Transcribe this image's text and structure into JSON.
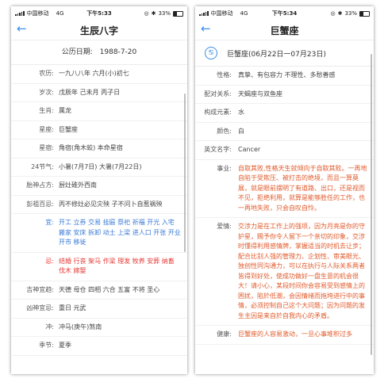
{
  "status": {
    "carrier": "中国移动",
    "network": "4G",
    "battery": "33%",
    "time_left": "下午5:33",
    "time_right": "下午5:34"
  },
  "left": {
    "title": "生辰八字",
    "date_label": "公历日期:",
    "date_value": "1988-7-20",
    "rows": [
      {
        "label": "农历:",
        "value": "一九八八年 六月(小)初七"
      },
      {
        "label": "岁次:",
        "value": "戊辰年 己未月 丙子日"
      },
      {
        "label": "生肖:",
        "value": "属龙"
      },
      {
        "label": "星座:",
        "value": "巨蟹座"
      },
      {
        "label": "星宿:",
        "value": "角宿(角木蛟) 本命星宿"
      },
      {
        "label": "24节气:",
        "value": "小暑(7月7日) 大暑(7月22日)"
      },
      {
        "label": "胎神占方:",
        "value": "厨灶碓外西南"
      },
      {
        "label": "彭祖百忌:",
        "value": "丙不修灶必见灾殃 子不问卜自惹祸殃"
      },
      {
        "label": "宜:",
        "value": "开工 立券 交易 挂匾 祭祀 祈福 开光 入宅 搬家 安床 拆卸 动土 上梁 进人口 开张 开业 开市 移徙",
        "style": "blue"
      },
      {
        "label": "忌:",
        "value": "结婚 行丧 架马 作梁 理发 牧养 安葬 纳畜 伐木 嫁娶",
        "style": "red"
      },
      {
        "label": "吉神宜趋:",
        "value": "天德 母仓 四相 六合 五富 不将 圣心"
      },
      {
        "label": "凶神宜忌:",
        "value": "重日 元武"
      },
      {
        "label": "冲:",
        "value": "冲马(庚午)煞南"
      },
      {
        "label": "季节:",
        "value": "夏季"
      }
    ]
  },
  "right": {
    "title": "巨蟹座",
    "zodiac_header": "巨蟹座(06月22日一07月23日)",
    "rows": [
      {
        "label": "性格:",
        "value": "真挚、有包容力 不理性、多愁善感"
      },
      {
        "label": "配对关系:",
        "value": "天蝎座与双鱼座"
      },
      {
        "label": "构成元素:",
        "value": "水"
      },
      {
        "label": "颜色:",
        "value": "白"
      },
      {
        "label": "英文名字:",
        "value": "Cancer"
      },
      {
        "label": "事业:",
        "value": "自取其败,性格天生就倾向于自取其败。一再地自陷于受欺压、被打击的绝境，而且一算莫展，就是眼前摆明了有道路、出口，还是视而不见，拒绝利用，就算是能够胜任的工作，也一再地失败，只会自叹自怜。"
      },
      {
        "label": "爱情:",
        "value": "交涉力是在工作上的强项，因为月亮是你的守护星，赐予你令人留下一个亲切的印象，交涉时懂得利用感情牌，掌握适当的时机去让步；配合比别人强的管理力、企划性、审美眼光、独创性同沟通力，可以在执行与人际关系两者皆得到好处，使成功做好一盘生意的机会很大！请小心，某段时间你会容易受到感情上的困扰，陷於低潮，会因情绪而拖垮进行中的事情，必须控制自己这个大问题；因为问题的发生主因是来自於自我内心的矛盾。"
      },
      {
        "label": "健康:",
        "value": "巨蟹座的人容易激动，一旦心事堆积过多"
      }
    ]
  }
}
